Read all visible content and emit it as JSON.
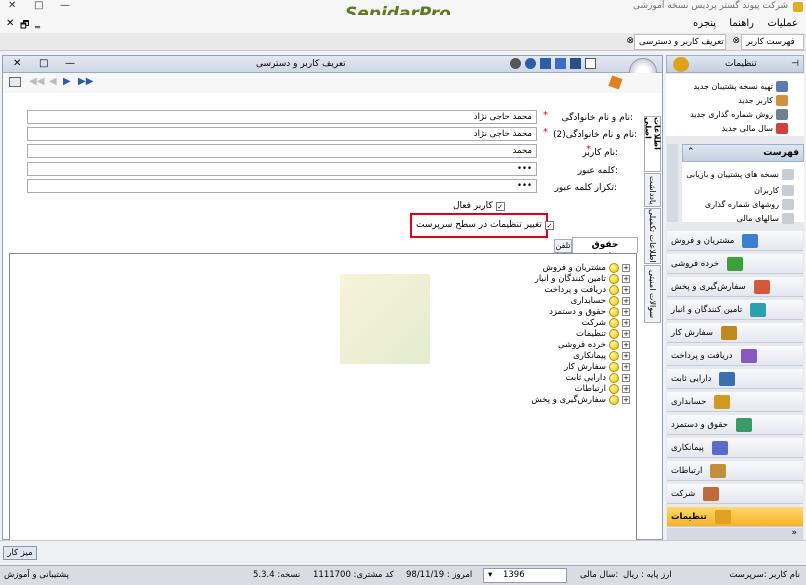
{
  "window": {
    "title": "شرکت پیوند گستر پردیس نسخه آموزشی",
    "brand": "SepidarPro",
    "min": "—",
    "restore": "□",
    "close": "✕"
  },
  "menu": {
    "items": [
      "عملیات",
      "راهنما",
      "پنجره"
    ],
    "close": "✕",
    "restore": "🗗",
    "min": "‗"
  },
  "tabs": [
    {
      "label": "فهرست کاربر"
    },
    {
      "label": "تعریف کاربر و دسترسی"
    }
  ],
  "form": {
    "title": "تعریف کاربر و دسترسی",
    "fields": [
      {
        "label": "نام و نام خانوادگی:",
        "value": "محمد حاجی نژاد"
      },
      {
        "label": "نام و نام خانوادگی(2):",
        "value": "محمد حاجی نژاد"
      },
      {
        "label": "نام کاربر:",
        "value": "محمد"
      },
      {
        "label": "کلمه عبور:",
        "value": "•••"
      },
      {
        "label": "تکرار کلمه عبور:",
        "value": "•••"
      }
    ],
    "active_user": "کاربر فعال",
    "admin_settings": "تغییر تنظیمات در سطح سرپرست",
    "side_tabs": [
      "اطلاعات اصلی",
      "یادداشت",
      "اطلاعات تکمیلی",
      "سوالات امنیتی"
    ],
    "subtabs": [
      "حقوق دسترسی",
      "تلفن"
    ]
  },
  "tree": [
    "مشتریان و فروش",
    "تامین کنندگان و انبار",
    "دریافت و پرداخت",
    "حسابداری",
    "حقوق و دستمزد",
    "شرکت",
    "تنظیمات",
    "خرده فروشی",
    "پیمانکاری",
    "سفارش کار",
    "دارایی ثابت",
    "ارتباطات",
    "سفارش‌گیری و پخش"
  ],
  "right": {
    "settings_header": "تنظیمات",
    "settings_items": [
      "تهیه نسخه پشتیبان جدید",
      "کاربر جدید",
      "روش شماره گذاری جدید",
      "سال مالی جدید"
    ],
    "list_header": "فهرست",
    "list_items": [
      "نسخه های پشتیبان و بازیابی",
      "کاربران",
      "روشهای شماره گذاری",
      "سالهای مالی"
    ],
    "nav": [
      "مشتریان و فروش",
      "خرده فروشی",
      "سفارش‌گیری و پخش",
      "تامین کنندگان و انبار",
      "سفارش کار",
      "دریافت و پرداخت",
      "دارایی ثابت",
      "حسابداری",
      "حقوق و دستمزد",
      "پیمانکاری",
      "ارتباطات",
      "شرکت",
      "تنظیمات"
    ],
    "nav_colors": [
      "#3a7fd0",
      "#3ea03a",
      "#d05a3a",
      "#2aa0b0",
      "#c08a20",
      "#8a56c0",
      "#3a70b0",
      "#d09a20",
      "#3a9a6a",
      "#5a6ad0",
      "#c0903a",
      "#c06a3a",
      "#e0a020"
    ]
  },
  "desktop_button": "میز کار",
  "status": {
    "user": "نام کاربر :سرپرست",
    "currency": "ارز پایه : ریال",
    "fy_label": "سال مالی:",
    "fy_value": "1396",
    "today": "امروز : 98/11/19",
    "customer_code": "کد مشتری: 1111700",
    "version": "نسخه: 5.3.4",
    "support": "پشتیبانی و آموزش"
  }
}
